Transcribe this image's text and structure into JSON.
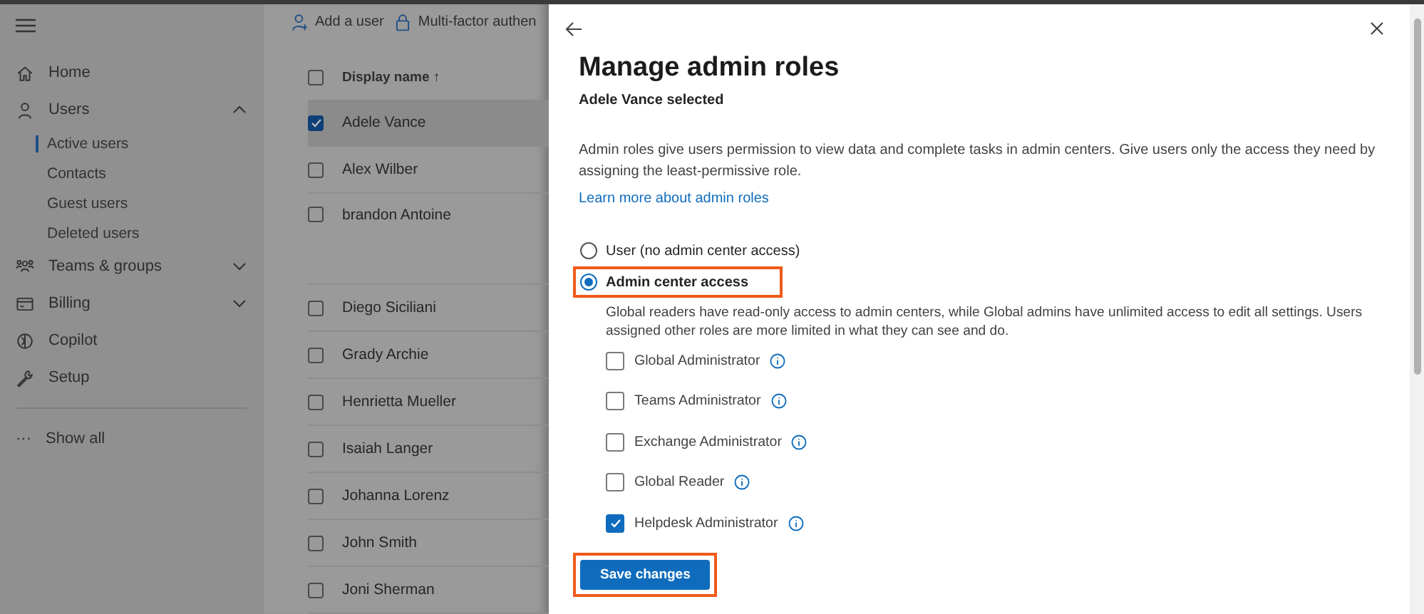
{
  "toolbar": [
    {
      "label": "Add a user"
    },
    {
      "label": "Multi-factor authen"
    }
  ],
  "nav": [
    {
      "label": "Home"
    },
    {
      "label": "Users",
      "expanded": true,
      "children": [
        {
          "label": "Active users",
          "selected": true
        },
        {
          "label": "Contacts",
          "selected": false
        },
        {
          "label": "Guest users",
          "selected": false
        },
        {
          "label": "Deleted users",
          "selected": false
        }
      ]
    },
    {
      "label": "Teams & groups",
      "expanded": false
    },
    {
      "label": "Billing",
      "expanded": false
    },
    {
      "label": "Copilot"
    },
    {
      "label": "Setup"
    }
  ],
  "show_all": {
    "icon": "···",
    "label": "Show all"
  },
  "table": {
    "header": {
      "label": "Display name",
      "sort": "↑",
      "checked": false
    },
    "rows": [
      {
        "name": "Adele Vance",
        "checked": true,
        "tall": false
      },
      {
        "name": "Alex Wilber",
        "checked": false,
        "tall": false
      },
      {
        "name": "brandon Antoine",
        "checked": false,
        "tall": true
      },
      {
        "name": "Diego Siciliani",
        "checked": false,
        "tall": false
      },
      {
        "name": "Grady Archie",
        "checked": false,
        "tall": false
      },
      {
        "name": "Henrietta Mueller",
        "checked": false,
        "tall": false
      },
      {
        "name": "Isaiah Langer",
        "checked": false,
        "tall": false
      },
      {
        "name": "Johanna Lorenz",
        "checked": false,
        "tall": false
      },
      {
        "name": "John Smith",
        "checked": false,
        "tall": false
      },
      {
        "name": "Joni Sherman",
        "checked": false,
        "tall": false
      }
    ]
  },
  "panel": {
    "title": "Manage admin roles",
    "subtitle": "Adele Vance selected",
    "description": "Admin roles give users permission to view data and complete tasks in admin centers. Give users only the access they need by assigning the least-permissive role.",
    "link": "Learn more about admin roles",
    "options": [
      {
        "label": "User (no admin center access)",
        "selected": false,
        "highlighted": false
      },
      {
        "label": "Admin center access",
        "selected": true,
        "highlighted": true
      }
    ],
    "roles_note": "Global readers have read-only access to admin centers, while Global admins have unlimited access to edit all settings. Users assigned other roles are more limited in what they can see and do.",
    "roles": [
      {
        "label": "Global Administrator",
        "checked": false
      },
      {
        "label": "Teams Administrator",
        "checked": false
      },
      {
        "label": "Exchange Administrator",
        "checked": false
      },
      {
        "label": "Global Reader",
        "checked": false
      },
      {
        "label": "Helpdesk Administrator",
        "checked": true
      }
    ],
    "save_button": {
      "label": "Save changes",
      "highlighted": true
    }
  }
}
